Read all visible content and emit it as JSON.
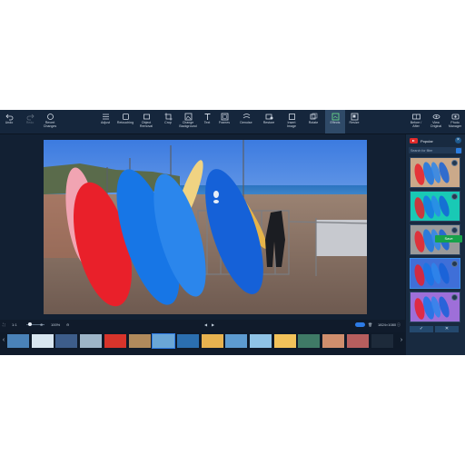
{
  "toolbar": {
    "items": [
      {
        "label": "Undo",
        "icon": "undo-icon"
      },
      {
        "label": "Redo",
        "icon": "redo-icon"
      },
      {
        "label": "Revert\nChanges",
        "icon": "revert-icon"
      },
      {
        "label": "Adjust",
        "icon": "sliders-icon"
      },
      {
        "label": "Retouching",
        "icon": "retouch-icon"
      },
      {
        "label": "Object\nRemoval",
        "icon": "eraser-icon"
      },
      {
        "label": "Crop",
        "icon": "crop-icon"
      },
      {
        "label": "Change\nBackground",
        "icon": "background-icon"
      },
      {
        "label": "Text",
        "icon": "text-icon"
      },
      {
        "label": "Frames",
        "icon": "frame-icon"
      },
      {
        "label": "Denoise",
        "icon": "denoise-icon"
      },
      {
        "label": "Restore",
        "icon": "restore-icon"
      },
      {
        "label": "Insert\nImage",
        "icon": "insert-image-icon"
      },
      {
        "label": "Rotate",
        "icon": "rotate-icon"
      },
      {
        "label": "Effects",
        "icon": "effects-icon"
      },
      {
        "label": "Resize",
        "icon": "resize-icon"
      }
    ],
    "right_items": [
      {
        "label": "Before /\nAfter",
        "icon": "before-after-icon"
      },
      {
        "label": "View\nOriginal",
        "icon": "eye-icon"
      },
      {
        "label": "Photo\nManager",
        "icon": "photo-manager-icon"
      }
    ]
  },
  "panel": {
    "title": "Popular",
    "search_placeholder": "Search for filter",
    "filters": [
      {
        "tint": "#caa98a"
      },
      {
        "tint": "#19c9b5"
      },
      {
        "tint": "#9a9a9a"
      },
      {
        "tint": "#3f6fd8"
      },
      {
        "tint": "#9e6fd9"
      }
    ],
    "close_icon": "close-icon",
    "apply_icon": "check-icon",
    "cancel_icon": "cancel-icon"
  },
  "bottom": {
    "zoom_value": "100%",
    "image_size": "1824×1080",
    "fit_icon": "fit-screen-icon",
    "ratio_label": "1:1"
  },
  "actions": {
    "save_label": "Save"
  },
  "filmstrip": {
    "thumbs": [
      "#4a82b8",
      "#d8e6f0",
      "#3d5d8a",
      "#9db5c8",
      "#d7342b",
      "#b08a5c",
      "#6aa6d6",
      "#2b6fb0",
      "#e7b24f",
      "#5d9bd0",
      "#8fc3e6",
      "#f2c25a",
      "#3f7a66",
      "#cf8e6d",
      "#b65e5e",
      "#1d2a3a"
    ]
  },
  "colors": {
    "accent": "#2d7be5",
    "save": "#17a24a",
    "toolbar_bg": "#15263c",
    "app_bg": "#101b2b"
  }
}
